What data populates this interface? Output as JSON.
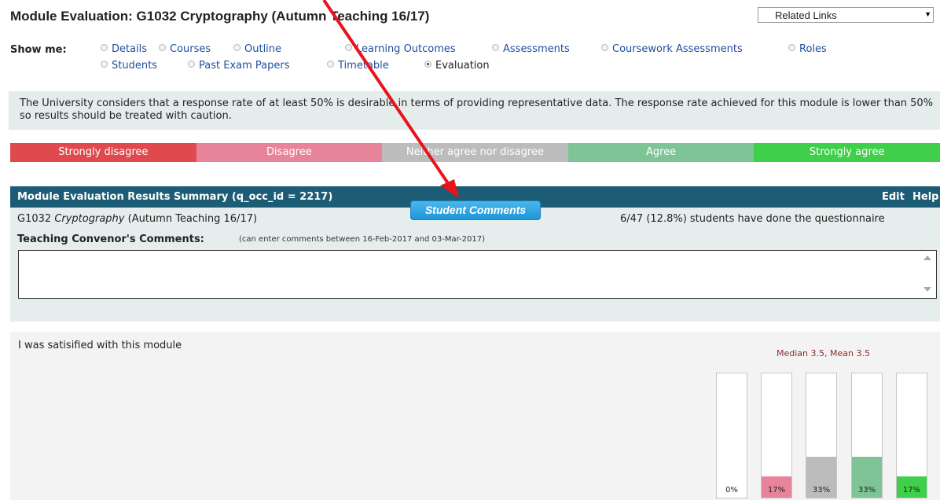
{
  "header": {
    "title": "Module Evaluation: G1032 Cryptography (Autumn Teaching 16/17)",
    "related_links": "Related Links"
  },
  "show_me": {
    "label": "Show me:",
    "options": [
      "Details",
      "Courses",
      "Outline",
      "Learning Outcomes",
      "Assessments",
      "Coursework Assessments",
      "Roles",
      "Students",
      "Past Exam Papers",
      "Timetable",
      "Evaluation"
    ],
    "selected": "Evaluation"
  },
  "notice": "The University considers that a response rate of at least 50% is desirable in terms of providing representative data. The response rate achieved for this module is lower than 50% so results should be treated with caution.",
  "scale": [
    {
      "label": "Strongly disagree",
      "color": "#e04a4f"
    },
    {
      "label": "Disagree",
      "color": "#e8849a"
    },
    {
      "label": "Neither agree nor disagree",
      "color": "#bcbcbc"
    },
    {
      "label": "Agree",
      "color": "#7ec496"
    },
    {
      "label": "Strongly agree",
      "color": "#3fcf4a"
    }
  ],
  "panel": {
    "title": "Module Evaluation Results Summary (q_occ_id = 2217)",
    "edit": "Edit",
    "help": "Help",
    "module_code": "G1032",
    "module_name": "Cryptography",
    "module_term": "(Autumn Teaching 16/17)",
    "student_comments_button": "Student Comments",
    "response_rate": "6/47 (12.8%) students have done the questionnaire",
    "convenor_label": "Teaching Convenor's Comments:",
    "convenor_hint": "(can enter comments between 16-Feb-2017 and 03-Mar-2017)",
    "convenor_comments": ""
  },
  "question": {
    "text": "I was satisified with this module",
    "stats": "Median 3.5, Mean 3.5",
    "bars": [
      {
        "label": "0%",
        "value": 0,
        "color": "#e04a4f"
      },
      {
        "label": "17%",
        "value": 17,
        "color": "#e8849a"
      },
      {
        "label": "33%",
        "value": 33,
        "color": "#bcbcbc"
      },
      {
        "label": "33%",
        "value": 33,
        "color": "#7ec496"
      },
      {
        "label": "17%",
        "value": 17,
        "color": "#3fcf4a"
      }
    ]
  },
  "annotation": {
    "arrow_color": "#e8141c"
  }
}
